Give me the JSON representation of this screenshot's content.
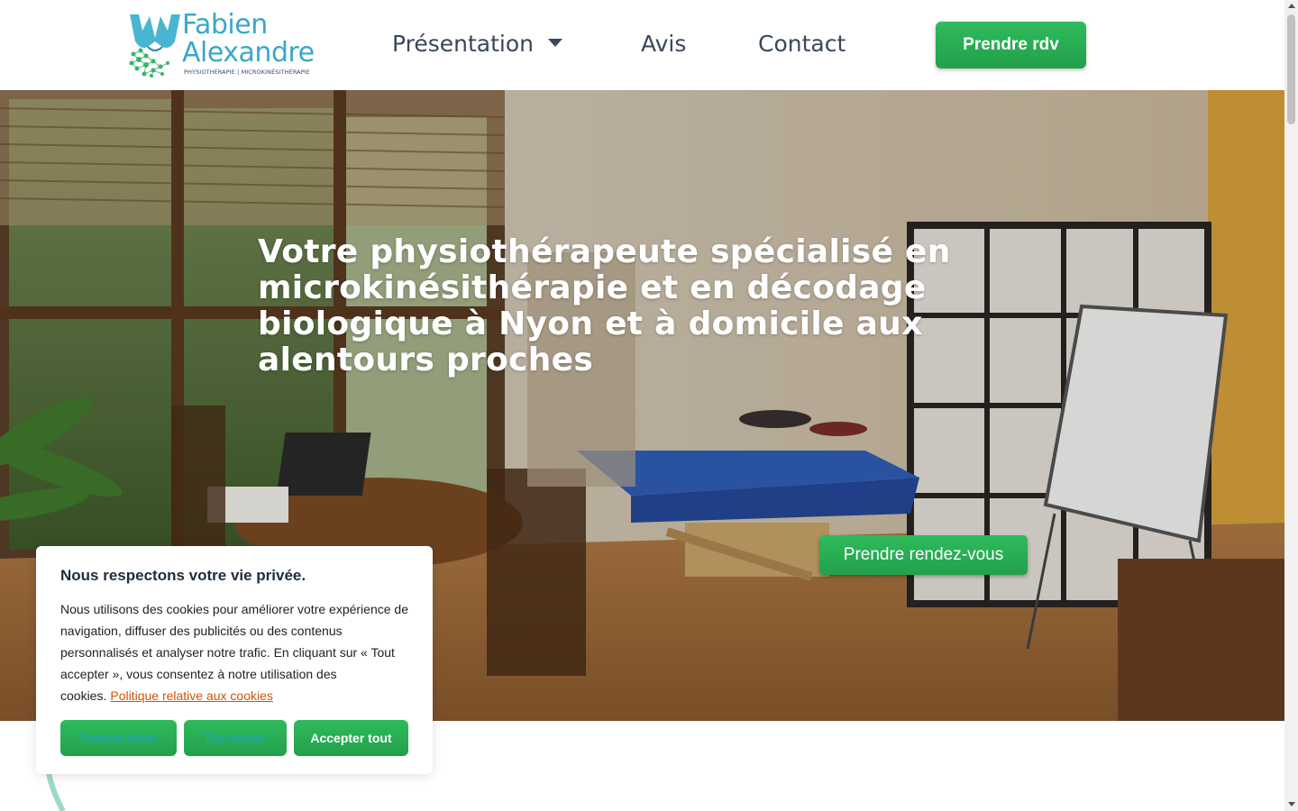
{
  "header": {
    "logo": {
      "name_line1": "Fabien",
      "name_line2": "Alexandre",
      "tagline": "PHYSIOTHÉRAPIE | MICROKINÉSITHÉRAPIE"
    },
    "nav": {
      "presentation": "Présentation",
      "avis": "Avis",
      "contact": "Contact"
    },
    "cta": "Prendre rdv"
  },
  "hero": {
    "title": "Votre physiothérapeute spécialisé en microkinésithérapie et en décodage biologique à Nyon et à domicile aux alentours proches",
    "cta": "Prendre rendez-vous"
  },
  "cookie_banner": {
    "title": "Nous respectons votre vie privée.",
    "text": "Nous utilisons des cookies pour améliorer votre expérience de navigation, diffuser des publicités ou des contenus personnalisés et analyser notre trafic. En cliquant sur « Tout accepter », vous consentez à notre utilisation des cookies.",
    "link": "Politique relative aux cookies",
    "buttons": {
      "customize": "Personnaliser",
      "reject": "Tout rejeter",
      "accept": "Accepter tout"
    }
  },
  "colors": {
    "brand_blue": "#3aa7c9",
    "brand_green": "#2fbb5c",
    "nav_text": "#39475a",
    "link_orange": "#d35400"
  }
}
